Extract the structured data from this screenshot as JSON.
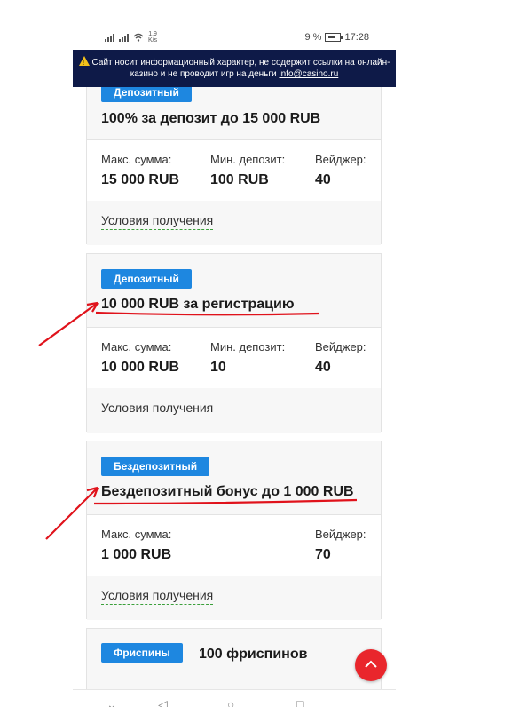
{
  "status_bar": {
    "speed_value": "1,9",
    "speed_unit": "K/s",
    "battery": "9 %",
    "time": "17:28"
  },
  "notice": {
    "text": "Сайт носит информационный характер, не содержит ссылки на онлайн-казино и не проводит игр на деньги",
    "email": "info@casino.ru"
  },
  "cards": [
    {
      "badge": "Депозитный",
      "title": "100% за депозит до 15 000 RUB",
      "stats": [
        {
          "label": "Макс. сумма:",
          "value": "15 000 RUB"
        },
        {
          "label": "Мин. депозит:",
          "value": "100 RUB"
        },
        {
          "label": "Вейджер:",
          "value": "40"
        }
      ],
      "conditions": "Условия получения"
    },
    {
      "badge": "Депозитный",
      "title": "10 000 RUB за регистрацию",
      "stats": [
        {
          "label": "Макс. сумма:",
          "value": "10 000 RUB"
        },
        {
          "label": "Мин. депозит:",
          "value": "10"
        },
        {
          "label": "Вейджер:",
          "value": "40"
        }
      ],
      "conditions": "Условия получения"
    },
    {
      "badge": "Бездепозитный",
      "title": "Бездепозитный бонус до 1 000 RUB",
      "stats": [
        {
          "label": "Макс. сумма:",
          "value": "1 000 RUB"
        },
        {
          "label": "Вейджер:",
          "value": "70"
        }
      ],
      "conditions": "Условия получения"
    },
    {
      "badge": "Фриспины",
      "title": "100 фриспинов"
    }
  ],
  "icons": {
    "warning": "warning-icon",
    "scroll_top": "chevron-up-icon",
    "annotation": "red-arrow"
  },
  "colors": {
    "badge": "#1e87e0",
    "notice_bg": "#0e1a48",
    "fab": "#e9262c",
    "annotation": "#e0121b"
  }
}
